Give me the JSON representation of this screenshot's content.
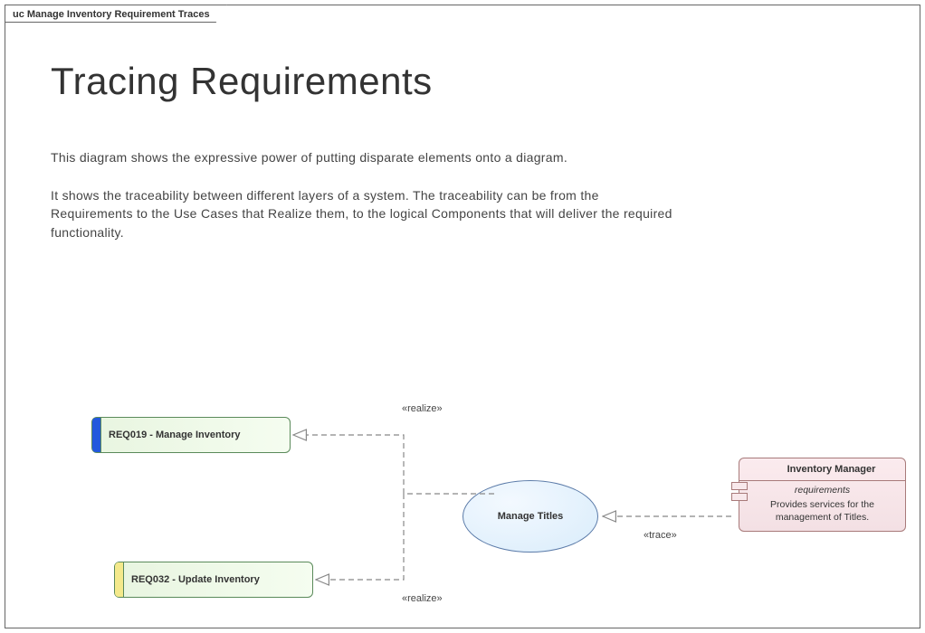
{
  "frame": {
    "title": "uc Manage Inventory Requirement Traces"
  },
  "heading": "Tracing Requirements",
  "desc1": "This diagram shows the expressive power of putting disparate elements onto a diagram.",
  "desc2": "It shows the traceability between different layers of a system.  The traceability can be from the Requirements to the Use Cases that Realize them, to the logical Components that will deliver the required functionality.",
  "req1": {
    "label": "REQ019 - Manage Inventory"
  },
  "req2": {
    "label": "REQ032 - Update Inventory"
  },
  "usecase": {
    "label": "Manage Titles"
  },
  "component": {
    "name": "Inventory Manager",
    "section": "requirements",
    "body": "Provides services for the management of Titles."
  },
  "labels": {
    "realize1": "«realize»",
    "realize2": "«realize»",
    "trace": "«trace»"
  }
}
